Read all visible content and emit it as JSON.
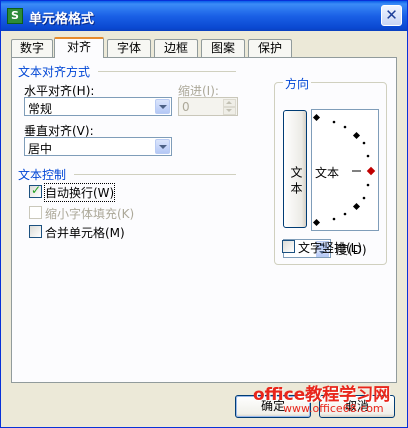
{
  "window": {
    "title": "单元格格式",
    "app_icon": "S"
  },
  "tabs": [
    {
      "label": "数字",
      "active": false
    },
    {
      "label": "对齐",
      "active": true
    },
    {
      "label": "字体",
      "active": false
    },
    {
      "label": "边框",
      "active": false
    },
    {
      "label": "图案",
      "active": false
    },
    {
      "label": "保护",
      "active": false
    }
  ],
  "alignment": {
    "group_title": "文本对齐方式",
    "horizontal_label": "水平对齐(H):",
    "horizontal_value": "常规",
    "indent_label": "缩进(I):",
    "indent_value": "0",
    "vertical_label": "垂直对齐(V):",
    "vertical_value": "居中"
  },
  "text_control": {
    "group_title": "文本控制",
    "wrap_label": "自动换行(W)",
    "wrap_checked": true,
    "shrink_label": "缩小字体填充(K)",
    "shrink_checked": false,
    "merge_label": "合并单元格(M)",
    "merge_checked": false
  },
  "orientation": {
    "group_title": "方向",
    "vertical_text_button": "文本",
    "dial_text": "文本",
    "angle_value": "0",
    "degree_label": "度(D)",
    "vertical_checkbox_label": "文字竖排(L)",
    "vertical_checked": false
  },
  "buttons": {
    "ok": "确定",
    "cancel": "取消"
  },
  "watermark": {
    "line1": "office教程学习网",
    "line2": "www.office68.com"
  },
  "colors": {
    "title_bar": "#0a5fe8",
    "group_title": "#0046d5",
    "tab_highlight": "#e68b2c",
    "check_tick": "#21a121",
    "dial_active": "#c00000"
  }
}
